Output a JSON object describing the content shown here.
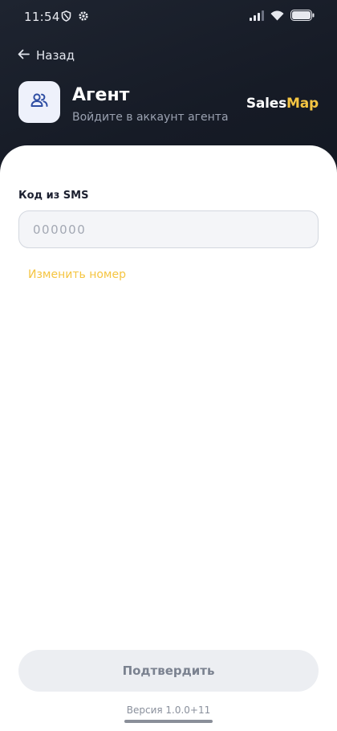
{
  "status_bar": {
    "time": "11:54",
    "icons": [
      "shield-icon",
      "gear-icon",
      "signal-icon",
      "wifi-icon",
      "battery-icon"
    ]
  },
  "header": {
    "back_label": "Назад",
    "title": "Агент",
    "subtitle": "Войдите в аккаунт агента",
    "brand_part1": "Sales",
    "brand_part2": "Map",
    "tile_icon": "users-icon"
  },
  "form": {
    "code_label": "Код из SMS",
    "code_value": "",
    "code_placeholder": "000000",
    "change_number": "Изменить номер",
    "confirm_label": "Подтвердить"
  },
  "footer": {
    "version": "Версия 1.0.0+11"
  },
  "colors": {
    "accent": "#f5c542",
    "header_bg": "#161b26",
    "tile_bg": "#eef1fb",
    "button_bg": "#eceef2",
    "button_text": "#7b8290"
  }
}
